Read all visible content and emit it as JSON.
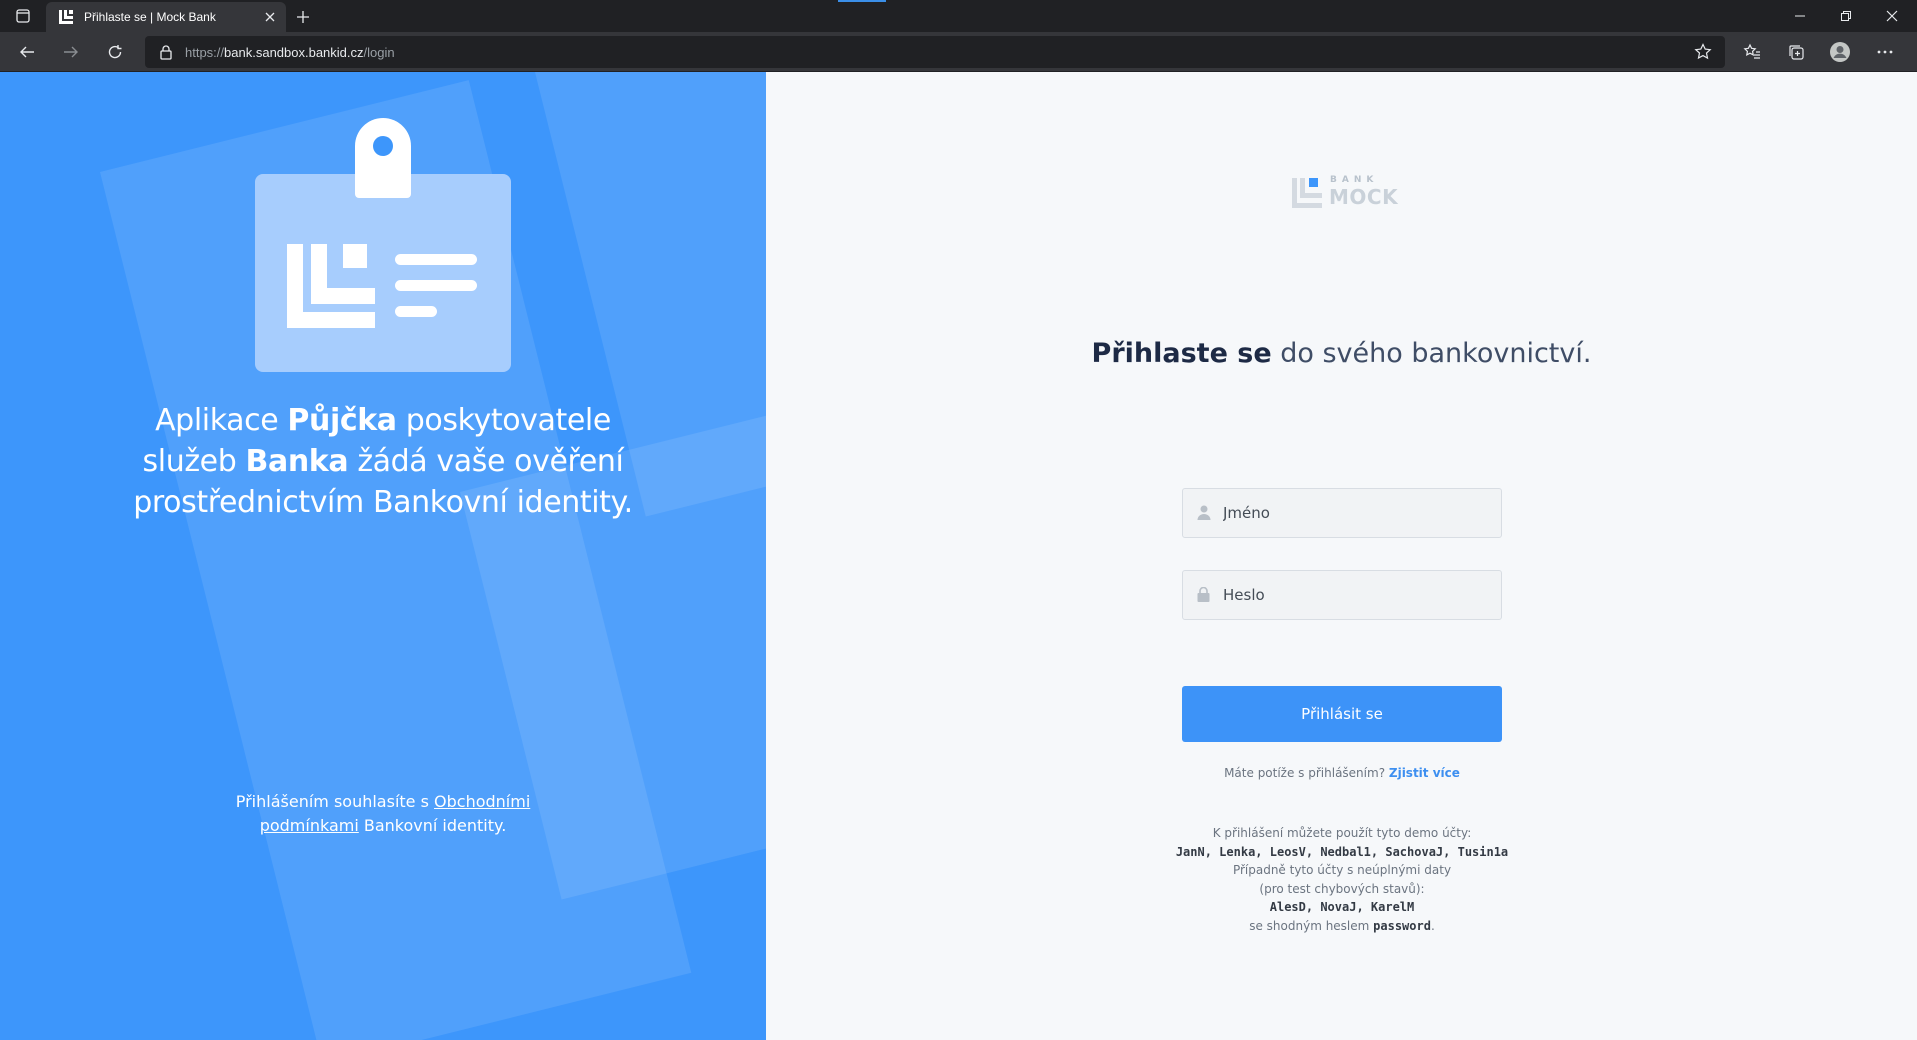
{
  "browser": {
    "tab_title": "Přihlaste se | Mock Bank",
    "url_scheme": "https://",
    "url_host": "bank.sandbox.bankid.cz",
    "url_path": "/login"
  },
  "left": {
    "line1_pre": "Aplikace ",
    "line1_bold": "Půjčka",
    "line1_post": " poskytovatele",
    "line2_pre": "služeb ",
    "line2_bold": "Banka",
    "line2_post": " žádá vaše ověření",
    "line3": "prostřednictvím Bankovní identity.",
    "terms_pre": "Přihlášením souhlasíte s ",
    "terms_link": "Obchodními podmínkami",
    "terms_post": " Bankovní identity."
  },
  "logo": {
    "small": "BANK",
    "big": "MOCK"
  },
  "login": {
    "heading_bold": "Přihlaste se",
    "heading_rest": " do svého bankovnictví.",
    "username_placeholder": "Jméno",
    "password_placeholder": "Heslo",
    "submit_label": "Přihlásit se",
    "trouble_text": "Máte potíže s přihlášením? ",
    "trouble_link": "Zjistit více"
  },
  "demo": {
    "intro": "K přihlášení můžete použít tyto demo účty:",
    "accounts": "JanN, Lenka, LeosV, Nedbal1, SachovaJ, Tusin1a",
    "alt_line1": "Případně tyto účty s neúplnými daty",
    "alt_line2": "(pro test chybových stavů):",
    "alt_accounts": "AlesD, NovaJ, KarelM",
    "password_pre": "se shodným heslem ",
    "password": "password",
    "password_post": "."
  },
  "colors": {
    "left_panel": "#3d96fb",
    "button": "#3d93f8",
    "link": "#3d8ff0"
  },
  "icons": [
    "window-menu-icon",
    "favicon-icon",
    "close-tab-icon",
    "new-tab-icon",
    "minimize-icon",
    "restore-icon",
    "close-window-icon",
    "back-icon",
    "forward-icon",
    "reload-icon",
    "lock-icon",
    "add-favorite-icon",
    "favorites-icon",
    "collections-icon",
    "profile-icon",
    "more-icon",
    "user-icon",
    "password-lock-icon",
    "id-card-illustration"
  ]
}
